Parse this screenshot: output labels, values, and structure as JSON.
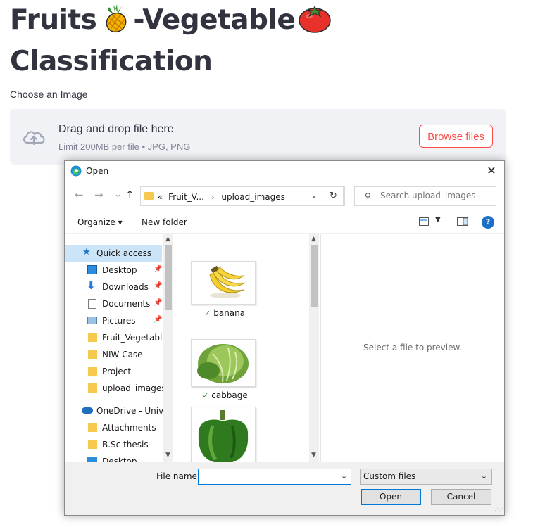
{
  "page": {
    "title_line1_a": "Fruits",
    "title_line1_b": "-Vegetable",
    "title_line2": "Classification",
    "title_emoji1": "pineapple-emoji",
    "title_emoji2": "tomato-emoji"
  },
  "uploader": {
    "label": "Choose an Image",
    "drop_text": "Drag and drop file here",
    "limit_text": "Limit 200MB per file • JPG, PNG",
    "browse_label": "Browse files",
    "accent": "#ff4b4b"
  },
  "dialog": {
    "title": "Open",
    "address_prefix": "«",
    "address_parent": "Fruit_V...",
    "address_sep": "›",
    "address_current": "upload_images",
    "search_placeholder": "Search upload_images",
    "toolbar": {
      "organize": "Organize ▾",
      "new_folder": "New folder"
    },
    "nav": {
      "quick_access": "Quick access",
      "desktop": "Desktop",
      "downloads": "Downloads",
      "documents": "Documents",
      "pictures": "Pictures",
      "fruit_vegetable": "Fruit_Vegetable_",
      "niw_case": "NIW Case",
      "project": "Project",
      "upload_images": "upload_images",
      "onedrive": "OneDrive - Univer",
      "attachments": "Attachments",
      "bsc_thesis": "B.Sc thesis",
      "desktop2": "Desktop"
    },
    "files": [
      {
        "name": "banana"
      },
      {
        "name": "cabbage"
      },
      {
        "name": ""
      }
    ],
    "preview_text": "Select a file to preview.",
    "file_name_label": "File name:",
    "file_name_value": "",
    "filter_value": "Custom files",
    "open_label": "Open",
    "cancel_label": "Cancel"
  }
}
